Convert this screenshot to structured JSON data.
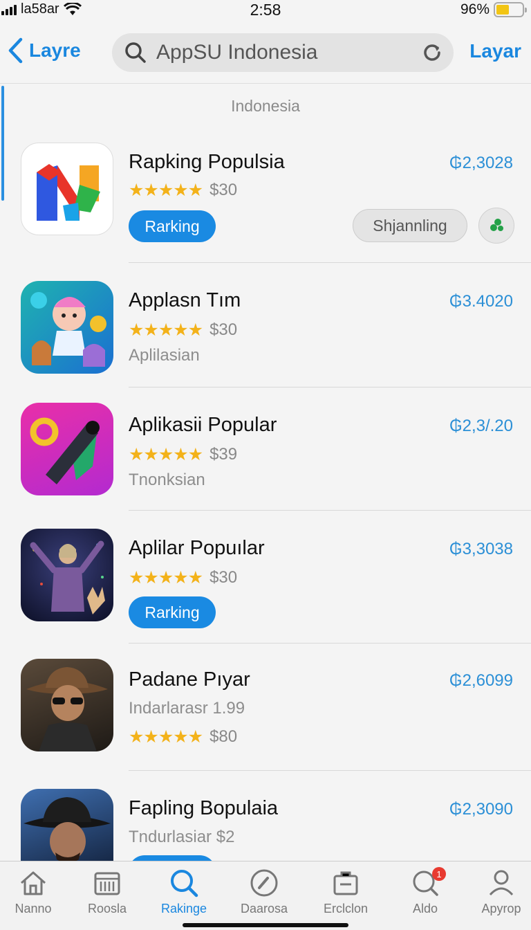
{
  "status": {
    "carrier": "la58ar",
    "time": "2:58",
    "battery": "96%"
  },
  "nav": {
    "back_label": "Layre",
    "search_text": "AppSU Indonesia",
    "right_label": "Layar"
  },
  "region_label": "Indonesia",
  "apps": [
    {
      "title": "Rapking Populsia",
      "price": "₲2,3028",
      "stars": "★★★★★",
      "cost": "$30",
      "button": "Rarking",
      "secondary_button": "Shjannling"
    },
    {
      "title": "Applasn Tım",
      "price": "₲3.4020",
      "stars": "★★★★★",
      "cost": "$30",
      "subtitle": "Aplilasian"
    },
    {
      "title": "Aplikasii Popular",
      "price": "₲2,3/.20",
      "stars": "★★★★★",
      "cost": "$39",
      "subtitle": "Tnonksian"
    },
    {
      "title": "Aplilar Popuılar",
      "price": "₲3,3038",
      "stars": "★★★★★",
      "cost": "$30",
      "button": "Rarking"
    },
    {
      "title": "Padane Pıyar",
      "price": "₲2,6099",
      "subtitle": "Indarlarasr 1.99",
      "stars": "★★★★★",
      "cost": "$80"
    },
    {
      "title": "Fapling Bopulaia",
      "price": "₲2,3090",
      "subtitle": "Tndurlasiar $2"
    }
  ],
  "tabs": [
    {
      "label": "Nanno",
      "icon": "home-icon"
    },
    {
      "label": "Roosla",
      "icon": "calendar-icon"
    },
    {
      "label": "Rakinge",
      "icon": "search-icon",
      "active": true
    },
    {
      "label": "Daarosa",
      "icon": "compass-icon"
    },
    {
      "label": "Erclclon",
      "icon": "briefcase-icon"
    },
    {
      "label": "Aldo",
      "icon": "search-badge-icon",
      "badge": "1"
    },
    {
      "label": "Apyrop",
      "icon": "person-icon"
    }
  ],
  "colors": {
    "accent": "#1a87df",
    "price": "#2b8fd6",
    "star": "#f3b21a",
    "badge": "#e83a30"
  }
}
